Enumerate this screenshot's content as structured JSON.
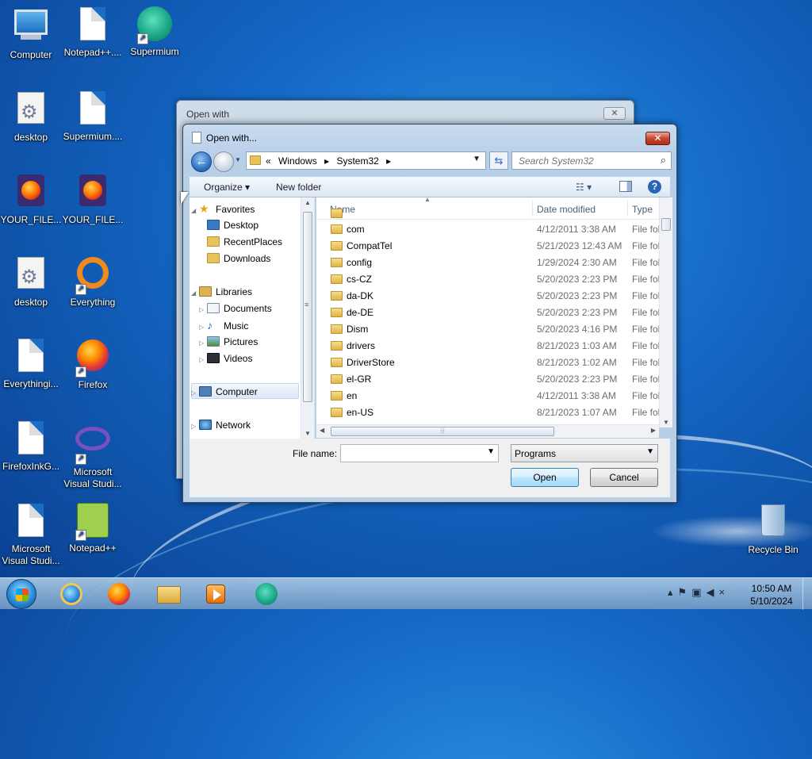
{
  "desktop": {
    "icons": [
      {
        "label": "Computer"
      },
      {
        "label": "Notepad++...."
      },
      {
        "label": "Supermium"
      },
      {
        "label": "desktop"
      },
      {
        "label": "Supermium...."
      },
      {
        "label": "YOUR_FILE..."
      },
      {
        "label": "YOUR_FILE..."
      },
      {
        "label": "desktop"
      },
      {
        "label": "Everything"
      },
      {
        "label": "Everythingi..."
      },
      {
        "label": "Firefox"
      },
      {
        "label": "FirefoxInkG..."
      },
      {
        "label": "Microsoft Visual Studi..."
      },
      {
        "label": "Microsoft Visual Studi..."
      },
      {
        "label": "Notepad++"
      },
      {
        "label": "Recycle Bin"
      }
    ]
  },
  "background_window": {
    "title": "Open with",
    "close_glyph": "✕"
  },
  "dialog": {
    "title": "Open with...",
    "close_glyph": "✕",
    "address": {
      "prefix": "«",
      "crumbs": [
        "Windows",
        "System32"
      ],
      "separator": "▸"
    },
    "search": {
      "placeholder": "Search System32"
    },
    "toolbar": {
      "organize": "Organize ▾",
      "new_folder": "New folder",
      "help": "?"
    },
    "nav": {
      "favorites": "Favorites",
      "desktop": "Desktop",
      "recent_places": "RecentPlaces",
      "downloads": "Downloads",
      "libraries": "Libraries",
      "documents": "Documents",
      "music": "Music",
      "pictures": "Pictures",
      "videos": "Videos",
      "computer": "Computer",
      "network": "Network"
    },
    "columns": {
      "name": "Name",
      "date": "Date modified",
      "type": "Type"
    },
    "files": [
      {
        "name": "com",
        "date": "4/12/2011 3:38 AM",
        "type": "File fol"
      },
      {
        "name": "CompatTel",
        "date": "5/21/2023 12:43 AM",
        "type": "File fol"
      },
      {
        "name": "config",
        "date": "1/29/2024 2:30 AM",
        "type": "File fol"
      },
      {
        "name": "cs-CZ",
        "date": "5/20/2023 2:23 PM",
        "type": "File fol"
      },
      {
        "name": "da-DK",
        "date": "5/20/2023 2:23 PM",
        "type": "File fol"
      },
      {
        "name": "de-DE",
        "date": "5/20/2023 2:23 PM",
        "type": "File fol"
      },
      {
        "name": "Dism",
        "date": "5/20/2023 4:16 PM",
        "type": "File fol"
      },
      {
        "name": "drivers",
        "date": "8/21/2023 1:03 AM",
        "type": "File fol"
      },
      {
        "name": "DriverStore",
        "date": "8/21/2023 1:02 AM",
        "type": "File fol"
      },
      {
        "name": "el-GR",
        "date": "5/20/2023 2:23 PM",
        "type": "File fol"
      },
      {
        "name": "en",
        "date": "4/12/2011 3:38 AM",
        "type": "File fol"
      },
      {
        "name": "en-US",
        "date": "8/21/2023 1:07 AM",
        "type": "File fol"
      }
    ],
    "filename": {
      "label": "File name:",
      "value": ""
    },
    "filter": {
      "selected": "Programs"
    },
    "buttons": {
      "open": "Open",
      "cancel": "Cancel"
    }
  },
  "taskbar": {
    "clock_time": "10:50 AM",
    "clock_date": "5/10/2024"
  }
}
